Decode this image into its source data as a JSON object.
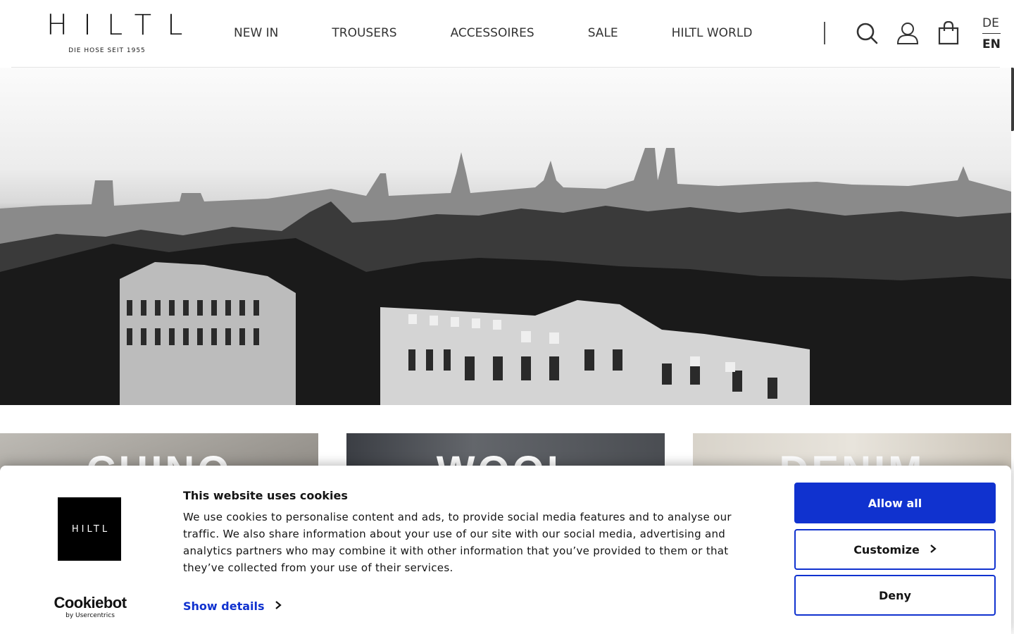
{
  "header": {
    "logo": {
      "wordmark": "HILTL",
      "tagline": "DIE HOSE SEIT 1955"
    },
    "nav": [
      {
        "label": "NEW IN"
      },
      {
        "label": "TROUSERS"
      },
      {
        "label": "ACCESSOIRES"
      },
      {
        "label": "SALE"
      },
      {
        "label": "HILTL WORLD"
      }
    ],
    "icons": {
      "search": "search-icon",
      "account": "user-icon",
      "cart": "shopping-bag-icon"
    },
    "languages": {
      "de": "DE",
      "en": "EN",
      "active": "EN"
    }
  },
  "hero": {
    "image": "black-and-white Munich skyline with Frauenkirche towers"
  },
  "categories": [
    {
      "label": "CHINO"
    },
    {
      "label": "WOOL"
    },
    {
      "label": "DENIM"
    }
  ],
  "cookie_banner": {
    "logo_text": "HILTL",
    "title": "This website uses cookies",
    "body": "We use cookies to personalise content and ads, to provide social media features and to analyse our traffic. We also share information about your use of our site with our social media, advertising and analytics partners who may combine it with other information that you’ve provided to them or that they’ve collected from your use of their services.",
    "show_details": "Show details",
    "provider": {
      "name": "Cookiebot",
      "by": "by Usercentrics"
    },
    "buttons": {
      "allow_all": "Allow all",
      "customize": "Customize",
      "deny": "Deny"
    },
    "colors": {
      "accent": "#1032cf"
    }
  }
}
